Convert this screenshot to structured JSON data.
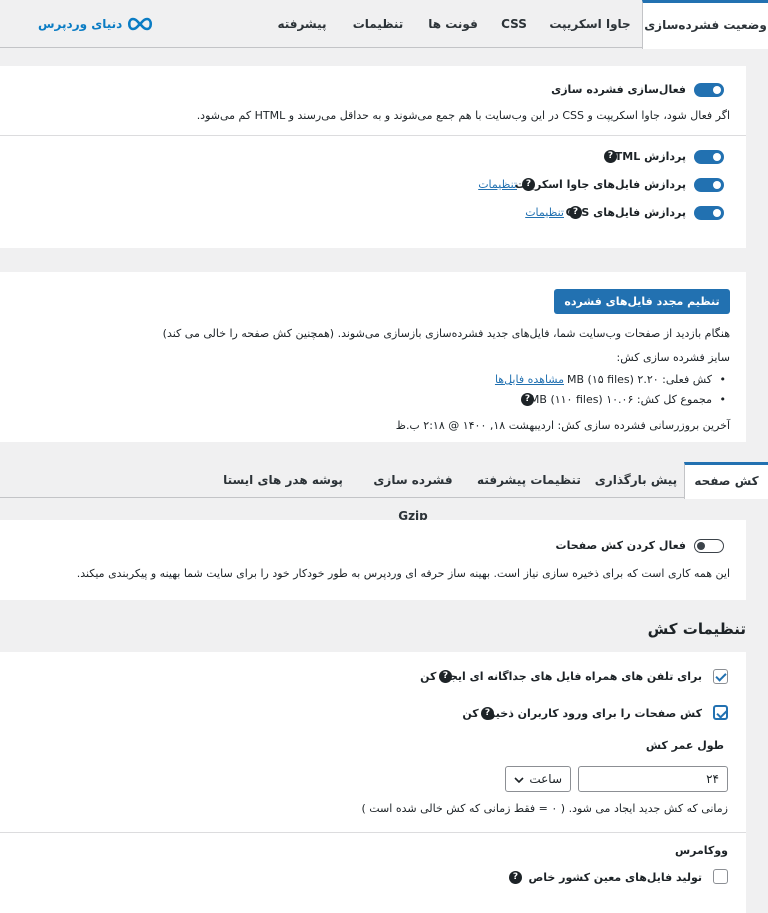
{
  "brand": {
    "name": "دنیای وردپرس",
    "icon": "infinity-logo-icon",
    "color": "#0a7cc4"
  },
  "top_tabs": [
    {
      "label": "وضعیت فشرده‌سازی",
      "active": true
    },
    {
      "label": "جاوا اسکریپت"
    },
    {
      "label": "CSS"
    },
    {
      "label": "فونت ها"
    },
    {
      "label": "تنظیمات"
    },
    {
      "label": "پیشرفته"
    }
  ],
  "minify": {
    "enable_label": "فعال‌سازی فشرده سازی",
    "description": "اگر فعال شود، جاوا اسکریپت و CSS در این وب‌سایت با هم جمع می‌شوند و به حداقل می‌رسند و HTML کم می‌شود.",
    "html_label": "پردازش HTML",
    "js_label": "پردازش فایل‌های جاوا اسکریپت",
    "js_settings": "تنظیمات",
    "css_label": "پردازش فایل‌های CSS",
    "css_settings": "تنظیمات",
    "help_glyph": "?"
  },
  "cache": {
    "reset_button": "تنظیم مجدد فایل‌های فشرده شده",
    "description": "هنگام بازدید از صفحات وب‌سایت شما، فایل‌های جدید فشرده‌سازی بازسازی می‌شوند. (همچنین کش صفحه را خالی می کند)",
    "size_label": "سایز فشرده سازی کش:",
    "current_cache": "کش فعلی: ۲.۲۰ MB (۱۵ files)",
    "view_files": "مشاهده فایل‌ها",
    "total_cache": "مجموع کل کش: ۱۰.۰۶ MB (۱۱۰ files)",
    "last_update": "آخرین بروزرسانی فشرده سازی کش: اردیبهشت ۱۸, ۱۴۰۰ @ ۲:۱۸ ب.ظ",
    "bullet": "•"
  },
  "mid_tabs": [
    {
      "label": "کش صفحه",
      "active": true
    },
    {
      "label": "پیش بارگذاری"
    },
    {
      "label": "تنظیمات پیشرفته"
    },
    {
      "label": "فشرده سازی Gzip"
    },
    {
      "label": "پوشه هدر های ایستا"
    }
  ],
  "page_cache": {
    "enable_label": "فعال کردن کش صفحات",
    "description": "این همه کاری است که برای ذخیره سازی نیاز است. بهینه ساز حرفه ای وردپرس به طور خودکار خود را برای سایت شما بهینه و پیکربندی میکند."
  },
  "cache_settings": {
    "heading": "تنظیمات کش",
    "mobile_label": "برای تلفن های همراه فایل های جداگانه ای ایجاد کن",
    "logged_in_label": "کش صفحات را برای ورود کاربران ذخیره کن",
    "lifespan_label": "طول عمر کش",
    "lifespan_value": "۲۴",
    "lifespan_unit": "ساعت",
    "lifespan_hint": "زمانی که کش جدید ایجاد می شود. ( ۰ = فقط زمانی که کش خالی شده است )",
    "woo_heading": "ووکامرس",
    "woo_country_label": "تولید فایل‌های معین کشور خاص"
  },
  "colors": {
    "accent": "#2271b1"
  }
}
